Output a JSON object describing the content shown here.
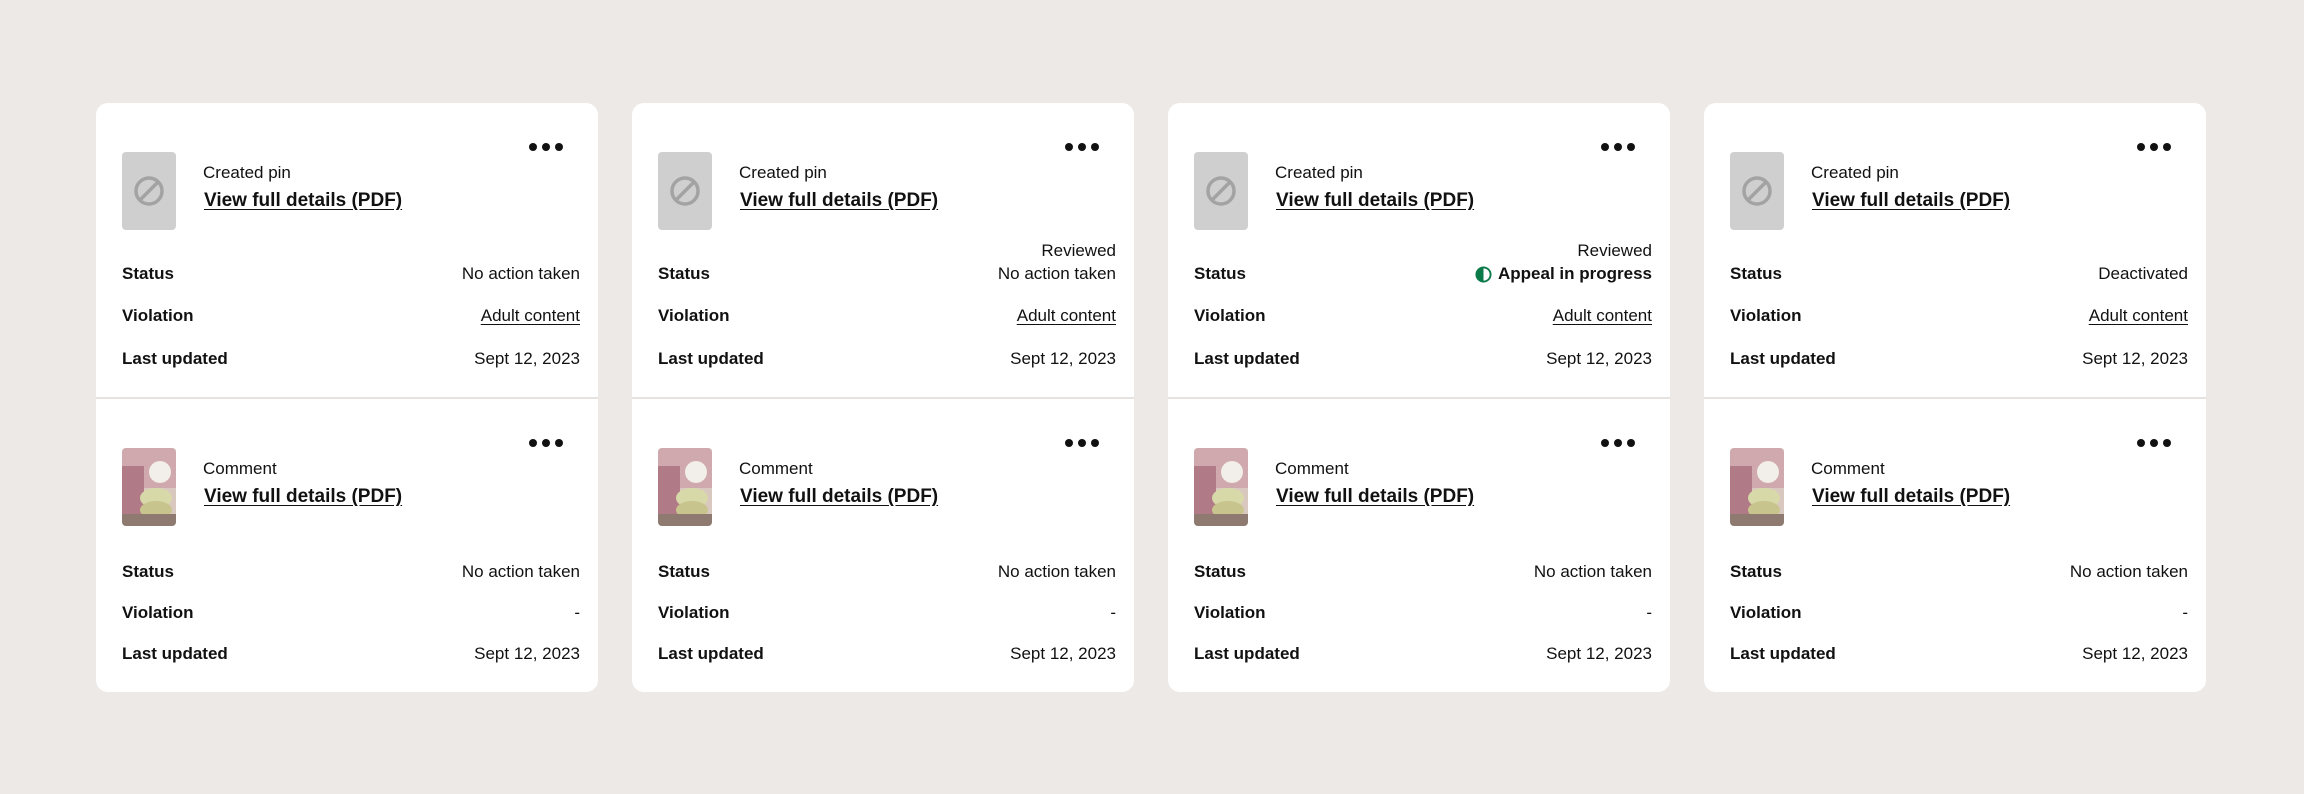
{
  "colors": {
    "background": "#ede9e6",
    "card": "#ffffff",
    "appeal_icon": "#0a7a48",
    "placeholder": "#cfcfcf"
  },
  "icons": {
    "more": "more-horizontal-icon",
    "placeholder": "blocked-icon",
    "appeal": "half-circle-icon"
  },
  "labels": {
    "status": "Status",
    "violation": "Violation",
    "last_updated": "Last updated",
    "details_link": "View full details (PDF)"
  },
  "cards": [
    {
      "top": {
        "type": "Created pin",
        "reviewed": "",
        "status": "No action taken",
        "violation": "Adult content",
        "last_updated": "Sept 12, 2023"
      },
      "bottom": {
        "type": "Comment",
        "status": "No action taken",
        "violation": "-",
        "last_updated": "Sept 12, 2023"
      }
    },
    {
      "top": {
        "type": "Created pin",
        "reviewed": "Reviewed",
        "status": "No action taken",
        "violation": "Adult content",
        "last_updated": "Sept 12, 2023"
      },
      "bottom": {
        "type": "Comment",
        "status": "No action taken",
        "violation": "-",
        "last_updated": "Sept 12, 2023"
      }
    },
    {
      "top": {
        "type": "Created pin",
        "reviewed": "Reviewed",
        "status": "Appeal in progress",
        "violation": "Adult content",
        "last_updated": "Sept 12, 2023"
      },
      "bottom": {
        "type": "Comment",
        "status": "No action taken",
        "violation": "-",
        "last_updated": "Sept 12, 2023"
      }
    },
    {
      "top": {
        "type": "Created pin",
        "reviewed": "",
        "status": "Deactivated",
        "violation": "Adult content",
        "last_updated": "Sept 12, 2023"
      },
      "bottom": {
        "type": "Comment",
        "status": "No action taken",
        "violation": "-",
        "last_updated": "Sept 12, 2023"
      }
    }
  ]
}
